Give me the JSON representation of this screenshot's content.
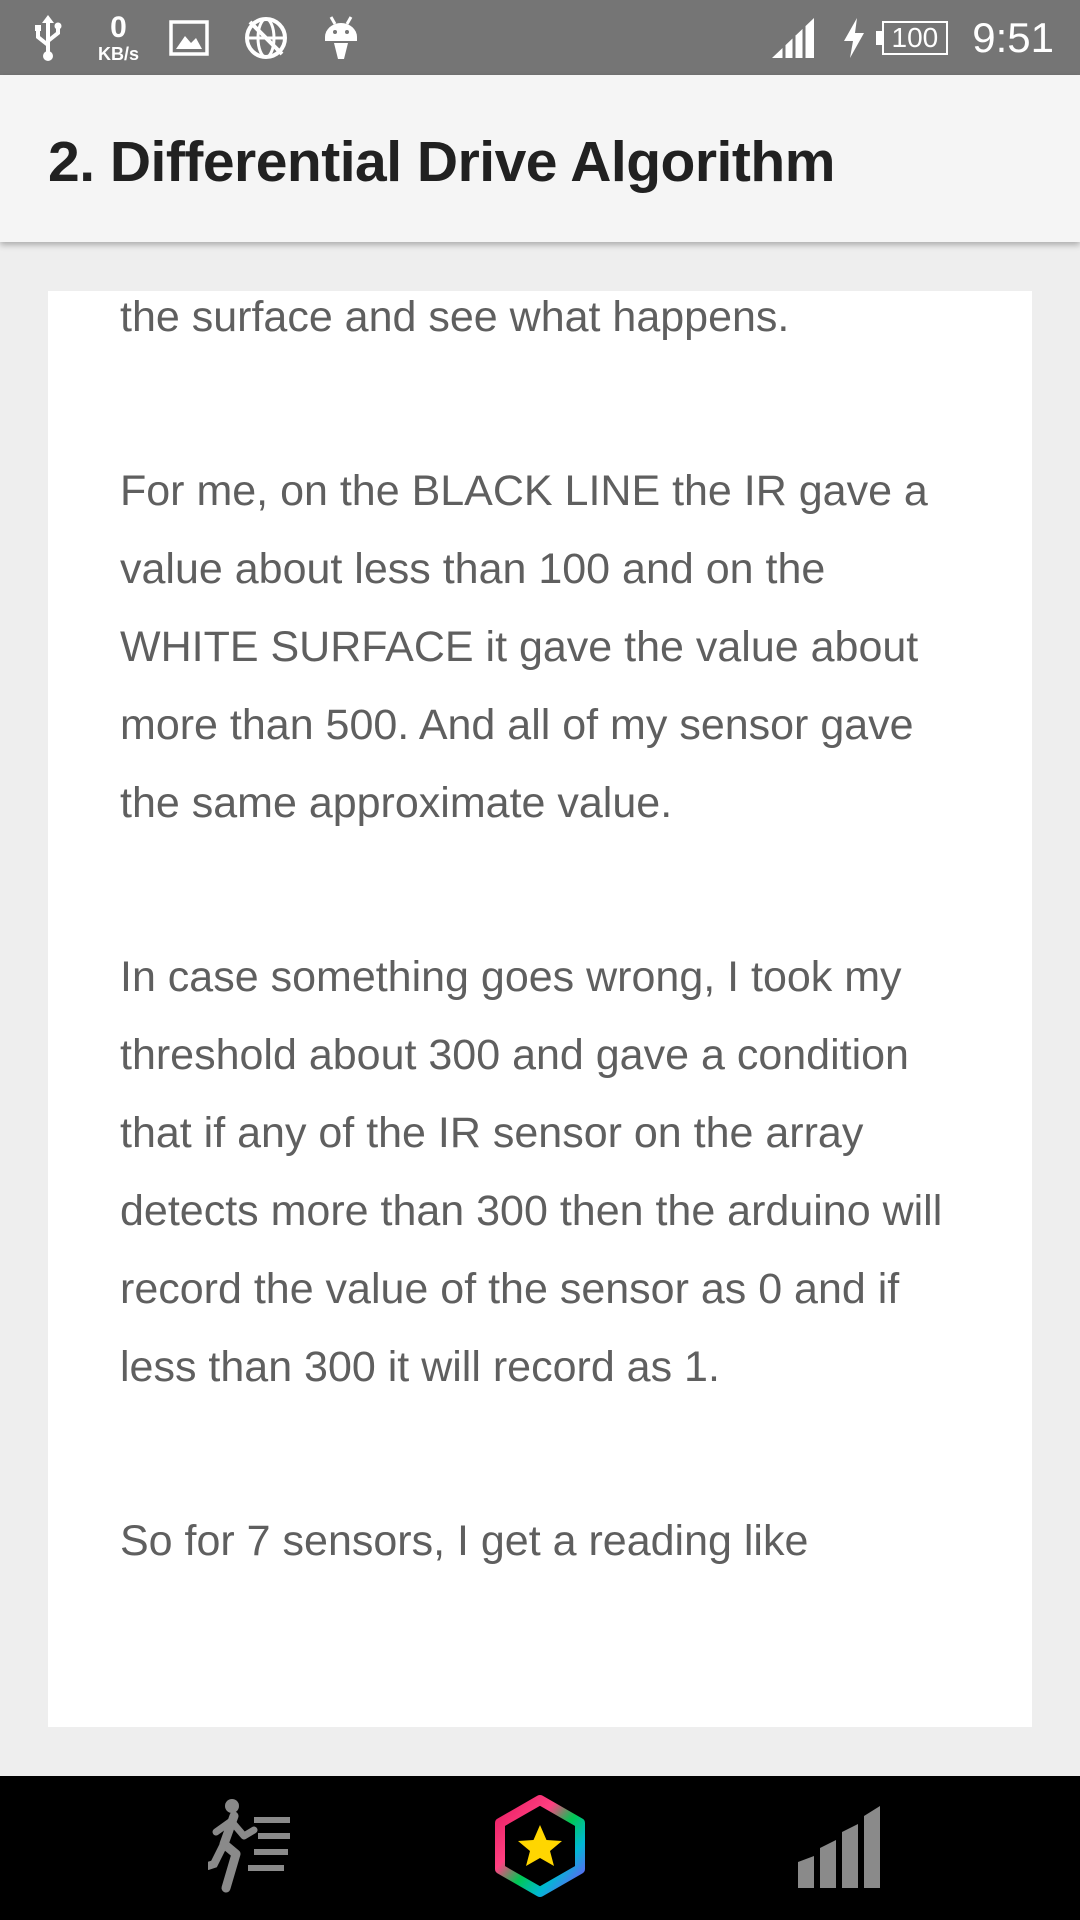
{
  "status_bar": {
    "icons_left": [
      "usb-icon",
      "data-speed-indicator",
      "image-icon",
      "no-globe-icon",
      "android-icon"
    ],
    "data_speed_value": "0",
    "data_speed_unit": "KB/s",
    "icons_right": [
      "signal-icon",
      "charging-icon",
      "battery-icon"
    ],
    "battery_level": "100",
    "time": "9:51"
  },
  "app_bar": {
    "title": "2. Differential Drive Algorithm"
  },
  "article": {
    "paragraphs": [
      "the surface and see what happens.",
      "For me, on the BLACK LINE the IR gave a value about less than 100 and on the WHITE SURFACE it gave the value about more than 500. And all of my sensor gave the same approximate value.",
      "In case something goes wrong, I took my threshold about 300 and gave a condition that if any of the IR sensor on the array detects more than 300 then the arduino will record the value of the sensor as 0 and if less than 300 it will record as 1.",
      "So for 7 sensors, I get a reading like"
    ]
  },
  "bottom_nav": {
    "items": [
      {
        "icon": "runner-list-icon"
      },
      {
        "icon": "hexagon-star-icon"
      },
      {
        "icon": "bar-chart-icon"
      }
    ]
  },
  "colors": {
    "status_bar": "#757575",
    "app_bar": "#f5f5f5",
    "background": "#eeeeee",
    "card": "#ffffff",
    "body_text": "#5f5f5f",
    "bottom_nav": "#000000",
    "star": "#ffd600"
  }
}
